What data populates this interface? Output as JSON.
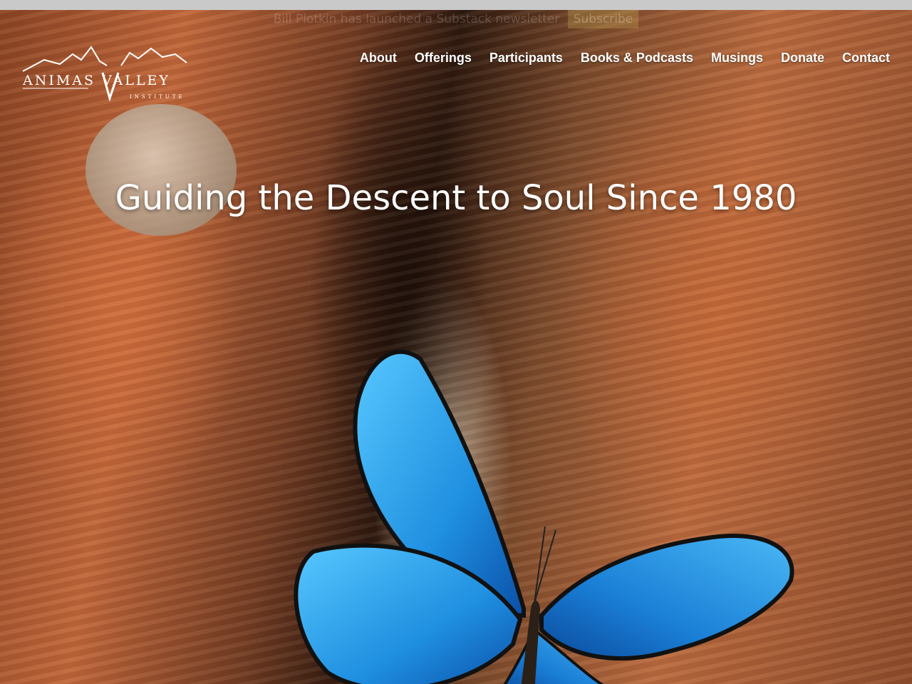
{
  "banner": {
    "text": "Bill Plotkin has launched a Substack newsletter",
    "button_label": "Subscribe"
  },
  "logo": {
    "wordmark": "ANIMAS VALLEY",
    "subtitle": "INSTITUTE"
  },
  "nav": {
    "items": [
      "About",
      "Offerings",
      "Participants",
      "Books & Podcasts",
      "Musings",
      "Donate",
      "Contact"
    ]
  },
  "hero": {
    "headline": "Guiding the Descent to Soul Since 1980"
  },
  "colors": {
    "nav_text": "#ffffff",
    "butterfly_blue": "#1f8fe0",
    "canyon_orange": "#c0663a"
  }
}
